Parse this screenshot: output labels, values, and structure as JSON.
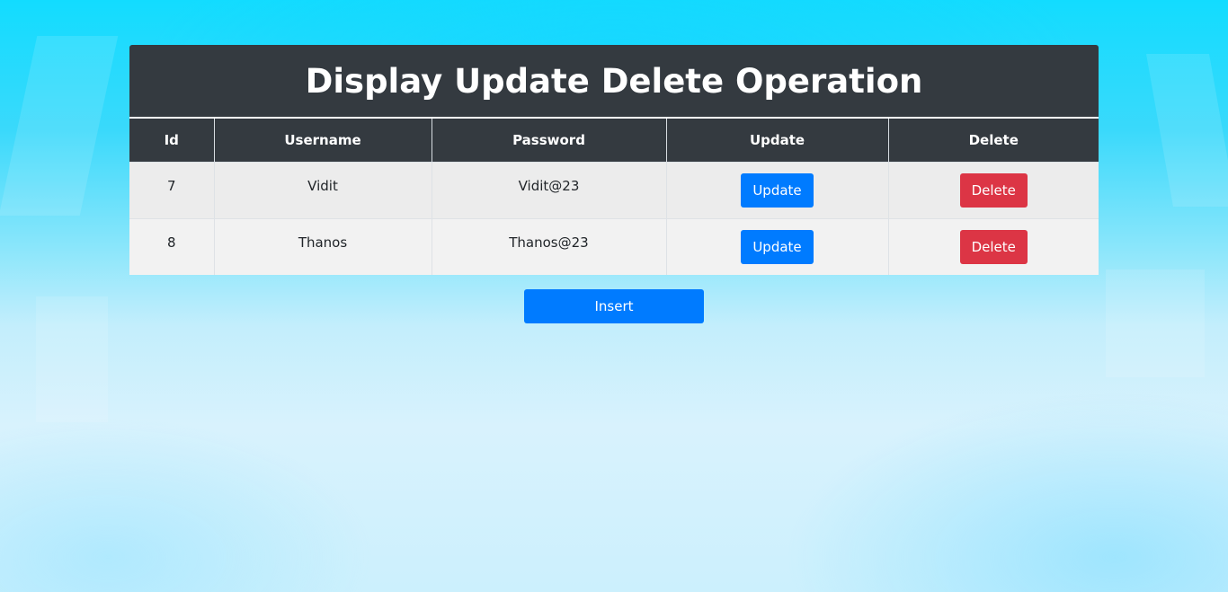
{
  "page": {
    "title": "Display Update Delete Operation"
  },
  "table": {
    "columns": [
      "Id",
      "Username",
      "Password",
      "Update",
      "Delete"
    ],
    "rows": [
      {
        "id": "7",
        "username": "Vidit",
        "password": "Vidit@23",
        "update_label": "Update",
        "delete_label": "Delete"
      },
      {
        "id": "8",
        "username": "Thanos",
        "password": "Thanos@23",
        "update_label": "Update",
        "delete_label": "Delete"
      }
    ]
  },
  "actions": {
    "insert_label": "Insert"
  },
  "colors": {
    "header_bg": "#343a40",
    "primary": "#007bff",
    "danger": "#dc3545",
    "background_top": "#12dcff",
    "background_bottom": "#d8f2fd"
  }
}
